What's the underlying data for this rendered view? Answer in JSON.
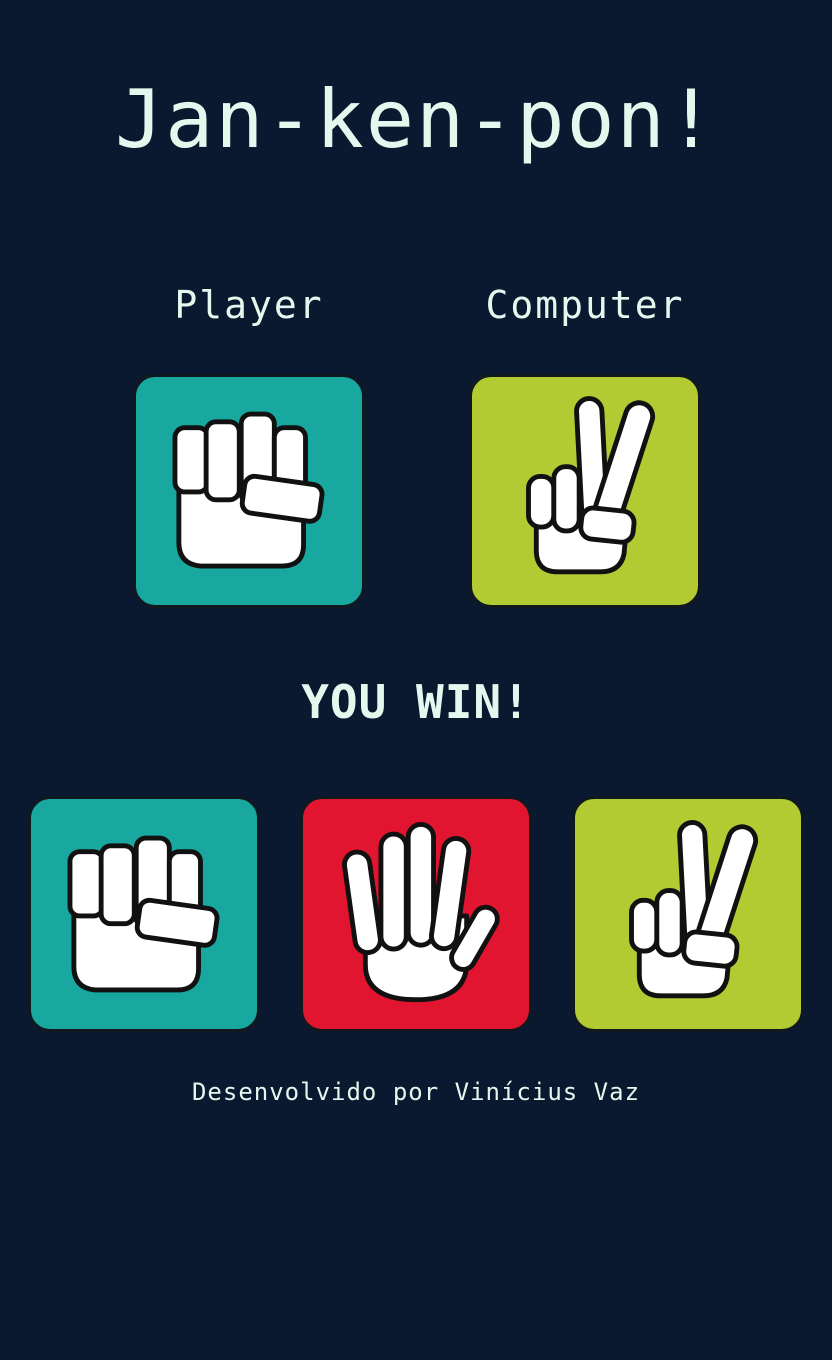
{
  "title": "Jan-ken-pon!",
  "labels": {
    "player": "Player",
    "computer": "Computer"
  },
  "player_choice": "rock",
  "computer_choice": "scissors",
  "result": "YOU WIN!",
  "choices": [
    {
      "id": "rock",
      "icon": "rock-fist-icon",
      "color": "#18a8a0"
    },
    {
      "id": "paper",
      "icon": "paper-hand-icon",
      "color": "#e11530"
    },
    {
      "id": "scissors",
      "icon": "scissors-hand-icon",
      "color": "#b3cb33"
    }
  ],
  "footer": "Desenvolvido por Vinícius Vaz"
}
